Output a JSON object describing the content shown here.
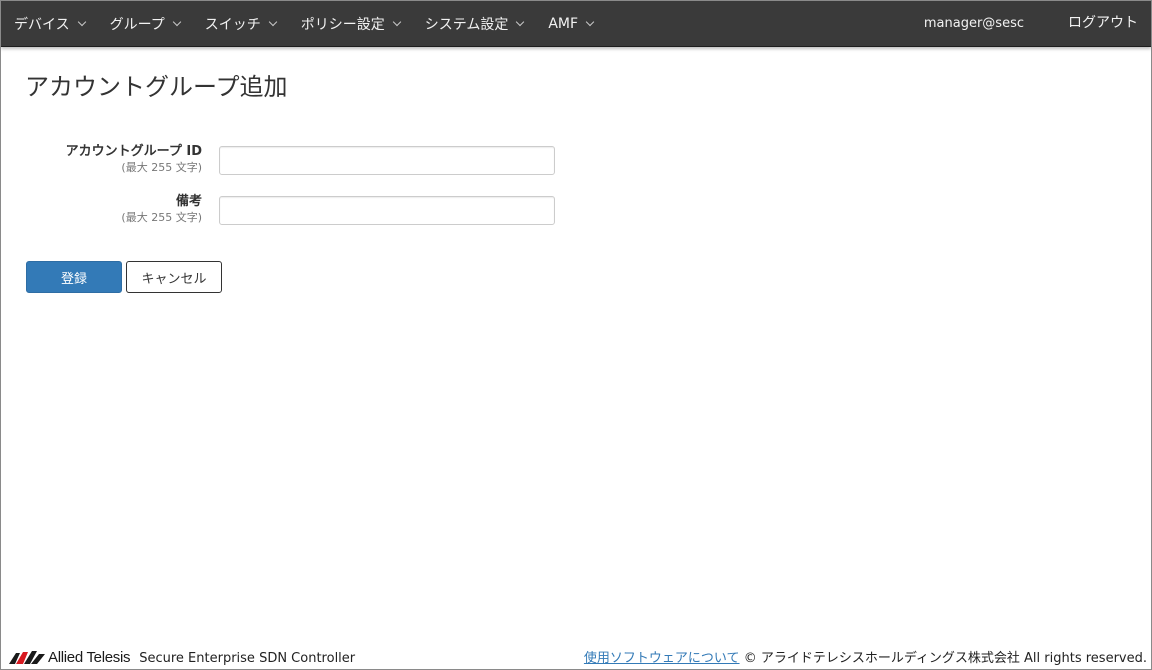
{
  "navbar": {
    "menu": [
      {
        "label": "デバイス"
      },
      {
        "label": "グループ"
      },
      {
        "label": "スイッチ"
      },
      {
        "label": "ポリシー設定"
      },
      {
        "label": "システム設定"
      },
      {
        "label": "AMF"
      }
    ],
    "user": "manager@sesc",
    "logout": "ログアウト"
  },
  "page": {
    "title": "アカウントグループ追加"
  },
  "form": {
    "fields": [
      {
        "label": "アカウントグループ ID",
        "hint": "(最大 255 文字)",
        "value": ""
      },
      {
        "label": "備考",
        "hint": "(最大 255 文字)",
        "value": ""
      }
    ],
    "submit_label": "登録",
    "cancel_label": "キャンセル"
  },
  "footer": {
    "brand": "Allied Telesis",
    "product": "Secure Enterprise SDN Controller",
    "link": "使用ソフトウェアについて",
    "copyright": "© アライドテレシスホールディングス株式会社 All rights reserved."
  },
  "colors": {
    "navbar_bg": "#3a3a3a",
    "primary": "#337ab7",
    "link": "#337ab7",
    "logo_red": "#d71920"
  }
}
